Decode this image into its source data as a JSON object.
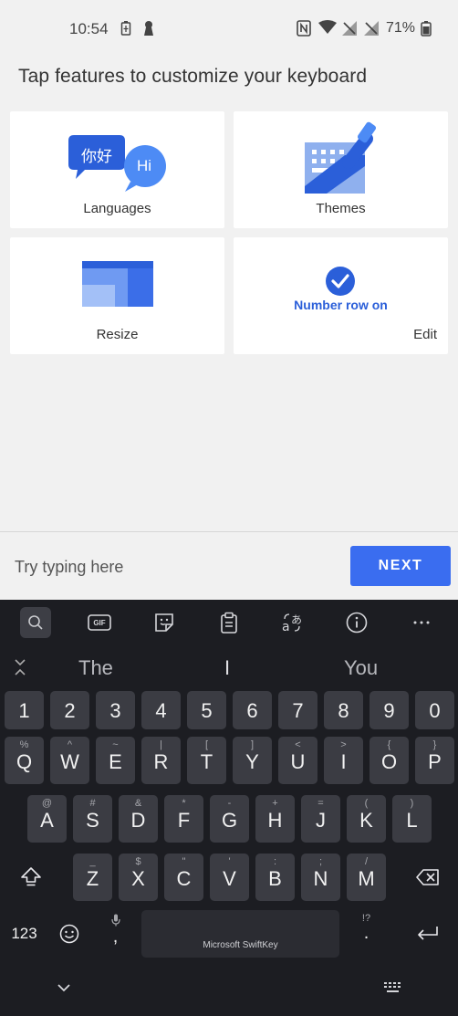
{
  "status_bar": {
    "time": "10:54",
    "battery_percent": "71%"
  },
  "page": {
    "heading": "Tap features to customize your keyboard",
    "cards": [
      {
        "label": "Languages",
        "bubble1": "你好",
        "bubble2": "Hi"
      },
      {
        "label": "Themes"
      },
      {
        "label": "Resize"
      },
      {
        "label": "Edit",
        "status": "Number row on"
      }
    ]
  },
  "input": {
    "placeholder": "Try typing here",
    "next_label": "NEXT"
  },
  "keyboard": {
    "toolbar": [
      "search-icon",
      "gif-icon",
      "sticker-icon",
      "clipboard-icon",
      "translate-icon",
      "info-icon",
      "more-icon"
    ],
    "gif_label": "GIF",
    "suggestions": [
      "The",
      "I",
      "You"
    ],
    "number_row": [
      "1",
      "2",
      "3",
      "4",
      "5",
      "6",
      "7",
      "8",
      "9",
      "0"
    ],
    "row1": [
      {
        "k": "Q",
        "a": "%"
      },
      {
        "k": "W",
        "a": "^"
      },
      {
        "k": "E",
        "a": "~"
      },
      {
        "k": "R",
        "a": "|"
      },
      {
        "k": "T",
        "a": "["
      },
      {
        "k": "Y",
        "a": "]"
      },
      {
        "k": "U",
        "a": "<"
      },
      {
        "k": "I",
        "a": ">"
      },
      {
        "k": "O",
        "a": "{"
      },
      {
        "k": "P",
        "a": "}"
      }
    ],
    "row2": [
      {
        "k": "A",
        "a": "@"
      },
      {
        "k": "S",
        "a": "#"
      },
      {
        "k": "D",
        "a": "&"
      },
      {
        "k": "F",
        "a": "*"
      },
      {
        "k": "G",
        "a": "-"
      },
      {
        "k": "H",
        "a": "+"
      },
      {
        "k": "J",
        "a": "="
      },
      {
        "k": "K",
        "a": "("
      },
      {
        "k": "L",
        "a": ")"
      }
    ],
    "row3": [
      {
        "k": "Z",
        "a": "_"
      },
      {
        "k": "X",
        "a": "$"
      },
      {
        "k": "C",
        "a": "\""
      },
      {
        "k": "V",
        "a": "'"
      },
      {
        "k": "B",
        "a": ":"
      },
      {
        "k": "N",
        "a": ";"
      },
      {
        "k": "M",
        "a": "/"
      }
    ],
    "mode_key": "123",
    "comma": ",",
    "period": ".",
    "period_alt": "!?",
    "spacebar": "Microsoft SwiftKey"
  },
  "colors": {
    "accent": "#3a6df0",
    "keyboard_bg": "#1c1d22",
    "key_bg": "#3b3c43"
  }
}
